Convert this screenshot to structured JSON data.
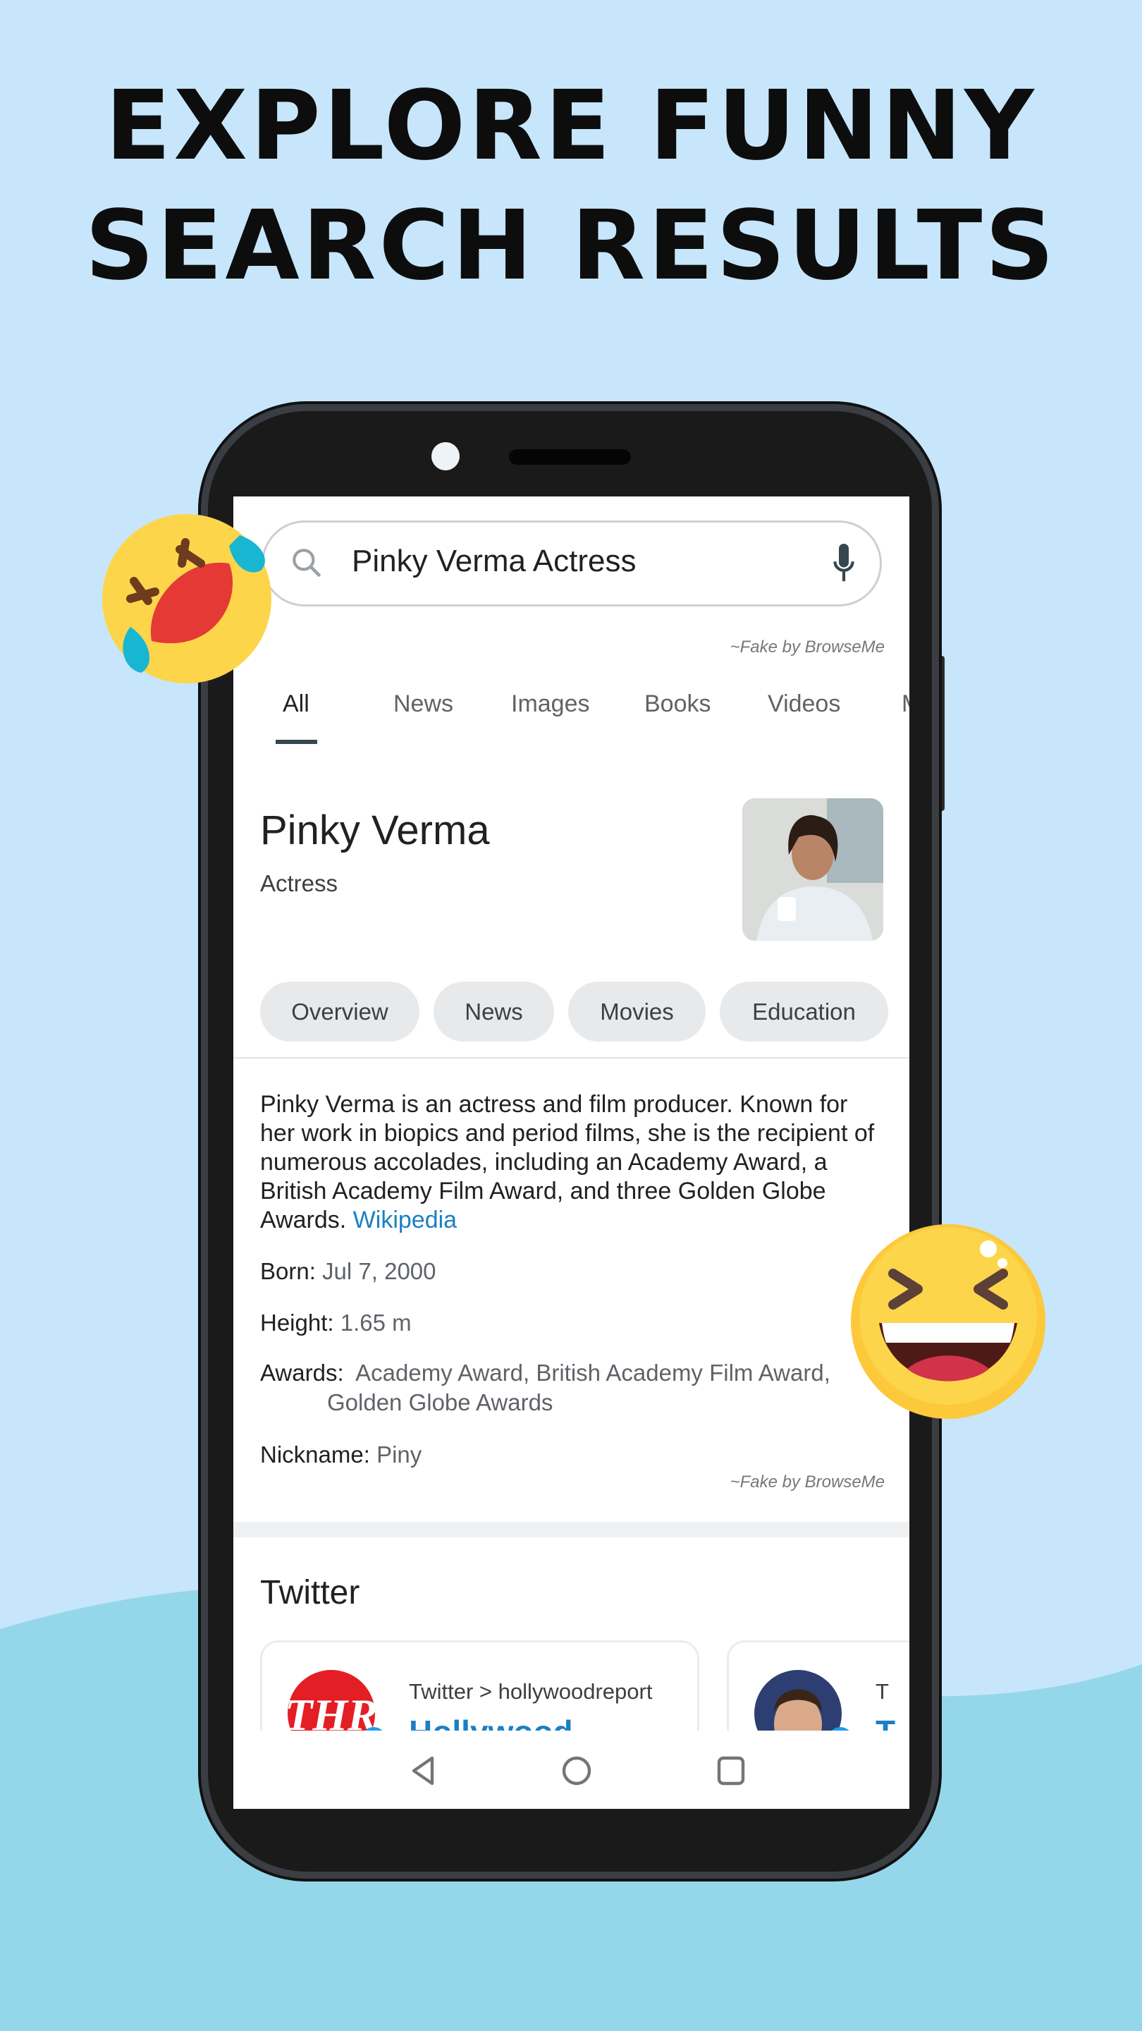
{
  "headline": {
    "line1": "EXPLORE FUNNY",
    "line2": "SEARCH RESULTS"
  },
  "search": {
    "query": "Pinky Verma Actress",
    "icon": "search-icon",
    "mic_icon": "mic-icon"
  },
  "watermark": "~Fake by BrowseMe",
  "tabs": [
    {
      "label": "All",
      "active": true
    },
    {
      "label": "News"
    },
    {
      "label": "Images"
    },
    {
      "label": "Books"
    },
    {
      "label": "Videos"
    },
    {
      "label": "M"
    }
  ],
  "knowledge_panel": {
    "name": "Pinky Verma",
    "subtitle": "Actress",
    "chips": [
      "Overview",
      "News",
      "Movies",
      "Education"
    ],
    "description": "Pinky Verma is an actress and film producer. Known for her work in biopics and period films, she is the recipient of numerous accolades, including an Academy Award, a British Academy Film Award, and three Golden Globe Awards.",
    "link": "Wikipedia",
    "facts": [
      {
        "label": "Born:",
        "value": "Jul 7, 2000"
      },
      {
        "label": "Height:",
        "value": "1.65 m"
      },
      {
        "label": "Awards:",
        "value": "Academy Award, British Academy Film Award,",
        "value2": "Golden Globe Awards"
      },
      {
        "label": "Nickname:",
        "value": "Piny"
      }
    ],
    "watermark": "~Fake by BrowseMe"
  },
  "twitter": {
    "title": "Twitter",
    "cards": [
      {
        "source": "Twitter > hollywoodreport",
        "name": "Hollywood",
        "logo": "THR"
      },
      {
        "source": "T",
        "name": "T"
      }
    ]
  },
  "colors": {
    "background": "#c7e6fb",
    "wave": "#95d7ea",
    "link": "#1b7fc4",
    "verified": "#1d9bf0"
  }
}
